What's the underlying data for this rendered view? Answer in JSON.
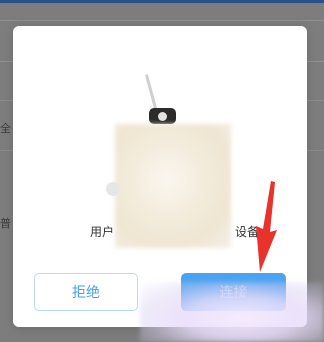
{
  "dialog": {
    "description_left": "用户",
    "description_right": "设备",
    "reject_label": "拒绝",
    "allow_label": "连接"
  },
  "background": {
    "edge_label_1": "全",
    "edge_label_2": "普"
  },
  "colors": {
    "primary": "#4aa3f2",
    "reject_border": "#b9dbf7",
    "reject_text": "#4a9ef0",
    "annotation_arrow": "#e8322b",
    "overlay": "#7f7f7f"
  },
  "icons": {
    "illustration": "security-camera-icon",
    "annotation": "red-arrow-icon"
  }
}
